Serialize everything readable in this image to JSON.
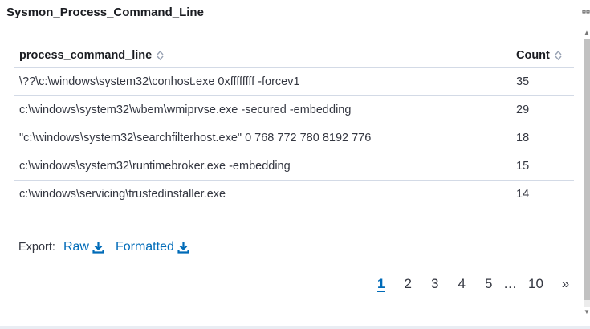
{
  "panel": {
    "title": "Sysmon_Process_Command_Line"
  },
  "table": {
    "headers": {
      "command_line": "process_command_line",
      "count": "Count"
    },
    "rows": [
      {
        "command_line": "\\??\\c:\\windows\\system32\\conhost.exe 0xffffffff -forcev1",
        "count": "35"
      },
      {
        "command_line": "c:\\windows\\system32\\wbem\\wmiprvse.exe -secured -embedding",
        "count": "29"
      },
      {
        "command_line": "\"c:\\windows\\system32\\searchfilterhost.exe\" 0 768 772 780 8192 776",
        "count": "18"
      },
      {
        "command_line": "c:\\windows\\system32\\runtimebroker.exe -embedding",
        "count": "15"
      },
      {
        "command_line": "c:\\windows\\servicing\\trustedinstaller.exe",
        "count": "14"
      }
    ],
    "icons": {
      "sort": "sort-icon"
    }
  },
  "export": {
    "label": "Export:",
    "raw_label": "Raw",
    "formatted_label": "Formatted",
    "icon": "download-icon"
  },
  "pagination": {
    "pages": [
      "1",
      "2",
      "3",
      "4",
      "5"
    ],
    "ellipsis": "…",
    "last_page": "10",
    "next": "»",
    "current": "1"
  },
  "colors": {
    "link": "#006bb8",
    "text": "#343741",
    "border": "#d3dae6"
  }
}
